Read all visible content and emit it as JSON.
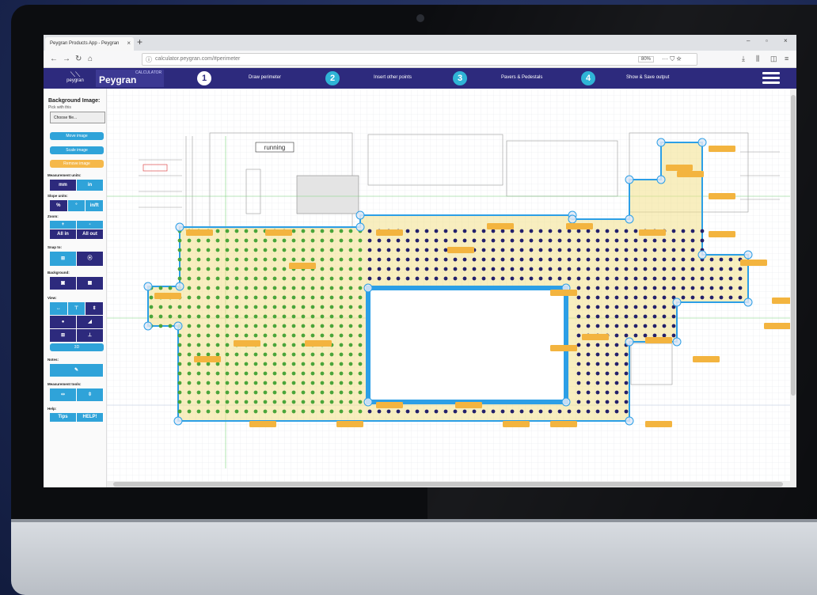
{
  "browser": {
    "tab_title": "Peygran Products App - Peygran",
    "tab_close": "×",
    "new_tab": "+",
    "url": "calculator.peygran.com/#perimeter",
    "zoom": "80%",
    "page_actions": "··· ⛉ ☆",
    "window_controls": [
      "–",
      "▫",
      "×"
    ]
  },
  "header": {
    "logo_text": "peygran",
    "brand_small": "CALCULATOR",
    "brand_name": "Peygran",
    "steps": [
      {
        "num": "1",
        "label": "Draw perimeter"
      },
      {
        "num": "2",
        "label": "Insert other points"
      },
      {
        "num": "3",
        "label": "Pavers & Pedestals"
      },
      {
        "num": "4",
        "label": "Show & Save output"
      }
    ]
  },
  "sidebar": {
    "bg_title": "Background Image:",
    "bg_hint": "Pick with this",
    "file_button": "Choose file...",
    "buttons": [
      "Move image",
      "Scale image",
      "Remove image"
    ],
    "measurement_units_label": "Measurement units:",
    "measurement_units": [
      "mm",
      "in"
    ],
    "slope_units_label": "Slope units:",
    "slope_units": [
      "%",
      "°",
      "in/ft"
    ],
    "zoom_label": "Zoom:",
    "zoom_buttons": [
      "+",
      "-",
      "All in",
      "All out"
    ],
    "snap_label": "Snap to:",
    "background_label": "Background:",
    "view_label": "View:",
    "view_3d": "3D",
    "notes_label": "Notes:",
    "measurement_tools_label": "Measurement tools:",
    "help_label": "Help:",
    "help_buttons": [
      "Tips",
      "HELP!"
    ]
  },
  "canvas": {
    "room_label": "running",
    "colors": {
      "grid": "#e3e6ea",
      "accent_blue": "#2c9fe6",
      "pedestal_green": "#4aa53a",
      "pedestal_navy": "#23206b",
      "area_fill": "#f3e08a",
      "label_orange": "#f3b43f"
    }
  }
}
